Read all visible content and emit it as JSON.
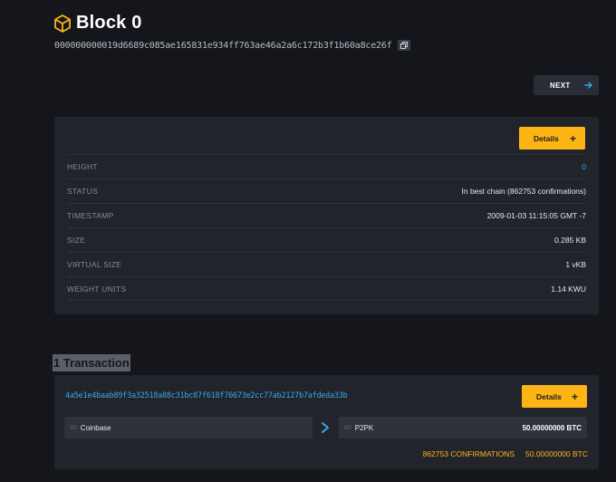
{
  "header": {
    "title": "Block 0",
    "hash": "000000000019d6689c085ae165831e934ff763ae46a2a6c172b3f1b60a8ce26f"
  },
  "nav": {
    "next_label": "NEXT"
  },
  "block_info": {
    "details_label": "Details",
    "rows": [
      {
        "label": "HEIGHT",
        "value": "0"
      },
      {
        "label": "STATUS",
        "value": "In best chain (862753 confirmations)"
      },
      {
        "label": "TIMESTAMP",
        "value": "2009-01-03 11:15:05 GMT -7"
      },
      {
        "label": "SIZE",
        "value": "0.285 KB"
      },
      {
        "label": "VIRTUAL SIZE",
        "value": "1 vKB"
      },
      {
        "label": "WEIGHT UNITS",
        "value": "1.14 KWU"
      }
    ]
  },
  "transactions": {
    "heading": "1 Transaction",
    "items": [
      {
        "txid": "4a5e1e4baab89f3a32518a88c31bc87f618f76673e2cc77ab2127b7afdeda33b",
        "details_label": "Details",
        "input": {
          "index": "#0",
          "name": "Coinbase"
        },
        "output": {
          "index": "#0",
          "type": "P2PK",
          "amount": "50.00000000 BTC"
        },
        "confirmations": "862753 CONFIRMATIONS",
        "total": "50.00000000 BTC"
      }
    ]
  },
  "colors": {
    "background": "#15161c",
    "card": "#22242c",
    "accent": "#fdb515",
    "link": "#3aa8e8"
  },
  "icons": [
    "cube-icon",
    "copy-icon",
    "arrow-right-icon",
    "plus-icon",
    "chevron-right-icon"
  ]
}
